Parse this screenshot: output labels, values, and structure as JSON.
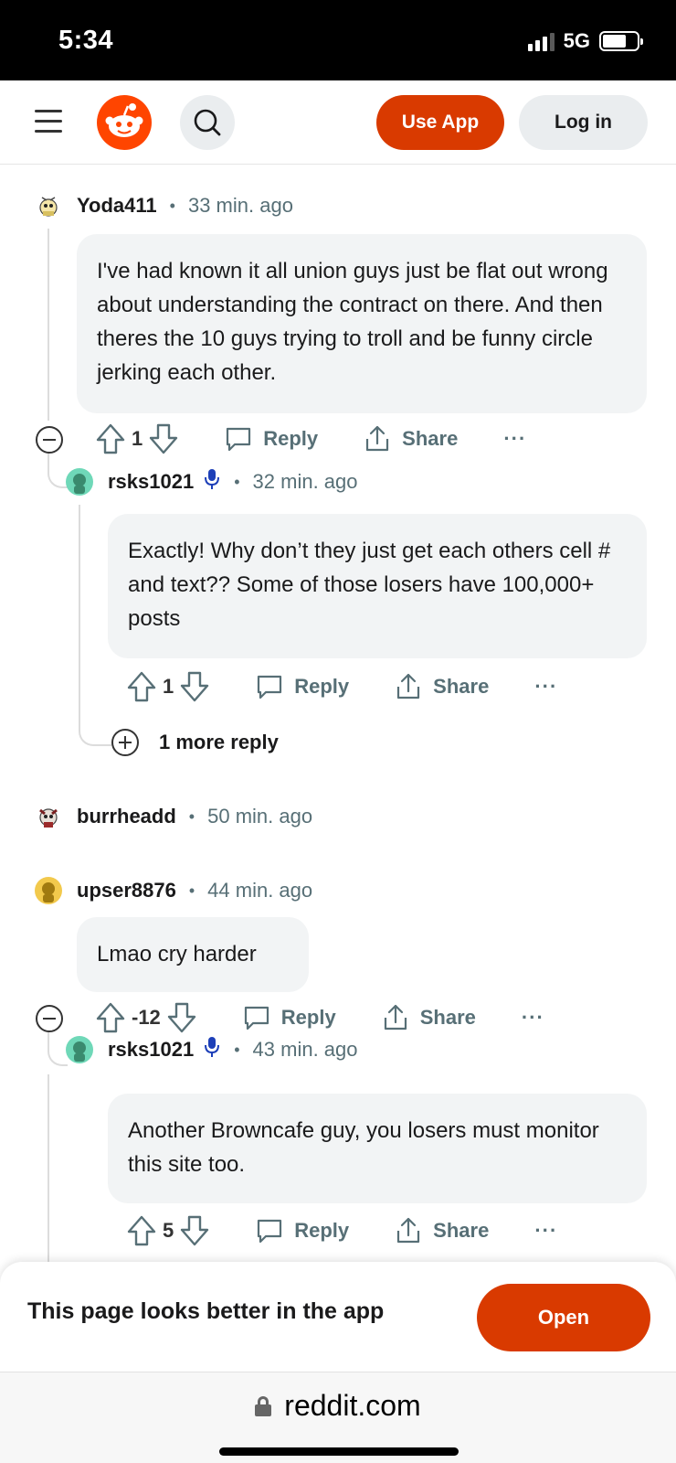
{
  "status_bar": {
    "time": "5:34",
    "network": "5G"
  },
  "header": {
    "use_app_label": "Use App",
    "login_label": "Log in"
  },
  "comments": [
    {
      "username": "Yoda411",
      "time": "33 min. ago",
      "text": "I've had known it all union guys just be flat out wrong about understanding the contract on there. And then theres the 10 guys trying to troll and be funny circle jerking each other.",
      "votes": "1",
      "reply_label": "Reply",
      "share_label": "Share",
      "more_label": "···"
    },
    {
      "username": "rsks1021",
      "time": "32 min. ago",
      "text": "Exactly! Why don’t they just get each others cell # and text?? Some of those losers have 100,000+ posts",
      "votes": "1",
      "reply_label": "Reply",
      "share_label": "Share",
      "more_label": "···",
      "more_replies_label": "1 more reply"
    },
    {
      "username": "burrheadd",
      "time": "50 min. ago"
    },
    {
      "username": "upser8876",
      "time": "44 min. ago",
      "text": "Lmao cry harder",
      "votes": "-12",
      "reply_label": "Reply",
      "share_label": "Share",
      "more_label": "···"
    },
    {
      "username": "rsks1021",
      "time": "43 min. ago",
      "text": "Another Browncafe guy, you losers must monitor this site too.",
      "votes": "5",
      "reply_label": "Reply",
      "share_label": "Share",
      "more_label": "···"
    }
  ],
  "separator": "•",
  "banner": {
    "text": "This page looks better in the app",
    "open_label": "Open"
  },
  "url_bar": {
    "domain": "reddit.com"
  },
  "colors": {
    "accent": "#d93a00",
    "reddit_orange": "#ff4500",
    "bubble": "#f2f4f5",
    "meta_gray": "#576f76",
    "mod_mic_blue": "#1d3fb8"
  }
}
